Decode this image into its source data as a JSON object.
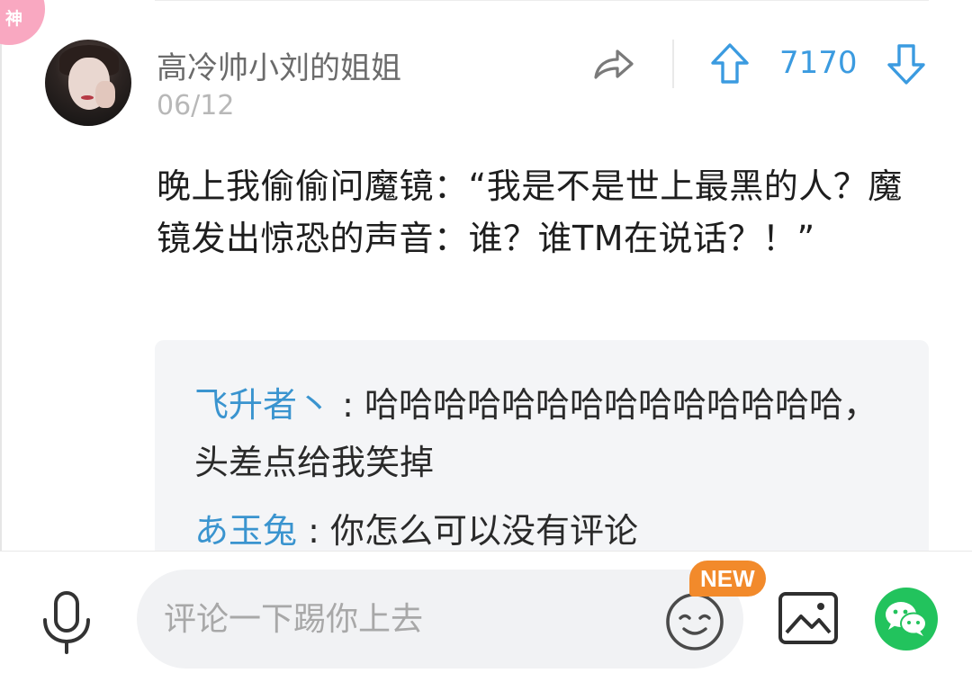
{
  "badge": {
    "label": "神"
  },
  "post": {
    "username": "高冷帅小刘的姐姐",
    "date": "06/12",
    "vote_count": "7170",
    "content": "晚上我偷偷问魔镜：“我是不是世上最黑的人？魔镜发出惊恐的声音：谁？谁TM在说话？！”"
  },
  "comments": [
    {
      "author": "飞升者丶",
      "separator": " : ",
      "text": "哈哈哈哈哈哈哈哈哈哈哈哈哈哈，头差点给我笑掉"
    },
    {
      "author": "あ玉兔",
      "separator": " : ",
      "text": "你怎么可以没有评论"
    }
  ],
  "bottom_bar": {
    "input_placeholder": "评论一下踢你上去",
    "new_badge": "NEW"
  },
  "colors": {
    "accent_blue": "#3b9be0",
    "author_blue": "#3a94cf",
    "badge_pink": "#f9a8c1",
    "new_orange": "#f28a2b",
    "wechat_green": "#22c35d"
  },
  "icons": {
    "share": "share-arrow-icon",
    "upvote": "up-arrow-icon",
    "downvote": "down-arrow-icon",
    "mic": "microphone-icon",
    "emoji": "smiley-icon",
    "image": "image-icon",
    "wechat": "wechat-icon"
  }
}
